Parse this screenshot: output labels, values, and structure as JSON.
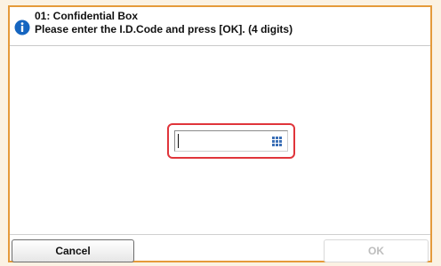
{
  "dialog": {
    "title": "01: Confidential Box",
    "message": "Please enter the I.D.Code and press [OK].  (4 digits)",
    "info_icon": "info-icon",
    "accent_color": "#e59a3a"
  },
  "code_field": {
    "value": "",
    "icon": "keypad-icon",
    "highlight_color": "#e0353b"
  },
  "buttons": {
    "cancel_label": "Cancel",
    "ok_label": "OK",
    "ok_enabled": false
  }
}
